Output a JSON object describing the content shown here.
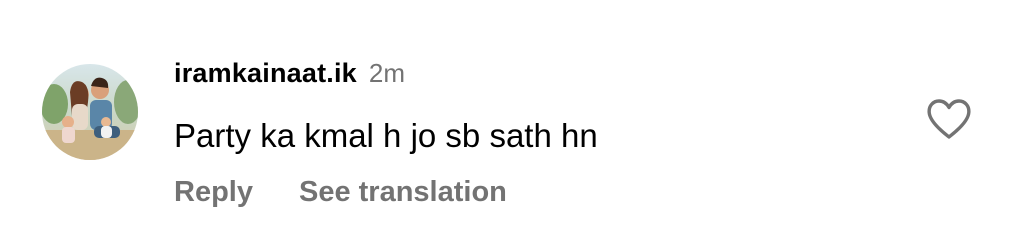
{
  "comment": {
    "username": "iramkainaat.ik",
    "time": "2m",
    "text": "Party ka kmal h jo sb sath hn",
    "reply_label": "Reply",
    "translate_label": "See translation",
    "like_icon": "heart-outline-icon",
    "avatar_icon": "profile-photo-family"
  },
  "colors": {
    "primary_text": "#000000",
    "secondary_text": "#737373",
    "background": "#ffffff"
  }
}
